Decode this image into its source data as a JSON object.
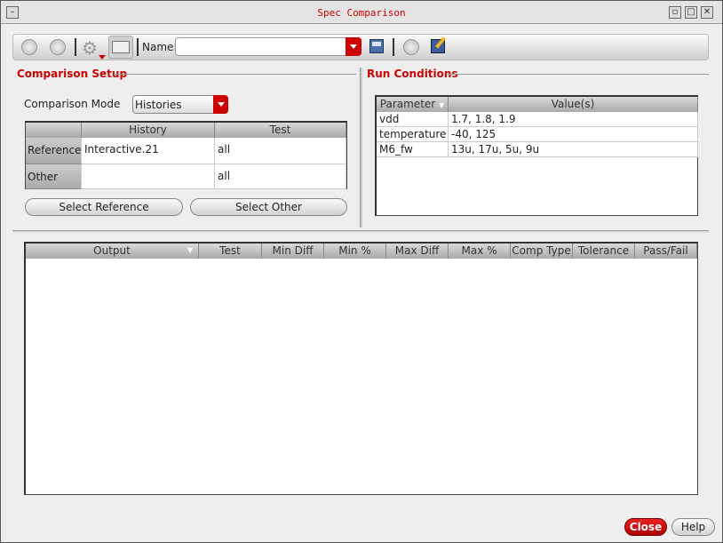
{
  "window": {
    "title": "Spec Comparison"
  },
  "toolbar": {
    "name_label": "Name:",
    "name_value": ""
  },
  "setup": {
    "title": "Comparison Setup",
    "mode_label": "Comparison Mode",
    "mode_value": "Histories",
    "headers": [
      "History",
      "Test"
    ],
    "rows": [
      {
        "label": "Reference",
        "history": "Interactive.21",
        "test": "all"
      },
      {
        "label": "Other",
        "history": "",
        "test": "all"
      }
    ],
    "select_reference": "Select Reference",
    "select_other": "Select Other"
  },
  "run": {
    "title": "Run Conditions",
    "headers": [
      "Parameter",
      "Value(s)"
    ],
    "rows": [
      {
        "param": "vdd",
        "value": "1.7, 1.8, 1.9"
      },
      {
        "param": "temperature",
        "value": "-40, 125"
      },
      {
        "param": "M6_fw",
        "value": "13u, 17u, 5u, 9u"
      }
    ]
  },
  "results": {
    "headers": [
      "Output",
      "Test",
      "Min Diff",
      "Min %",
      "Max Diff",
      "Max %",
      "Comp Type",
      "Tolerance",
      "Pass/Fail"
    ]
  },
  "footer": {
    "close": "Close",
    "help": "Help"
  }
}
